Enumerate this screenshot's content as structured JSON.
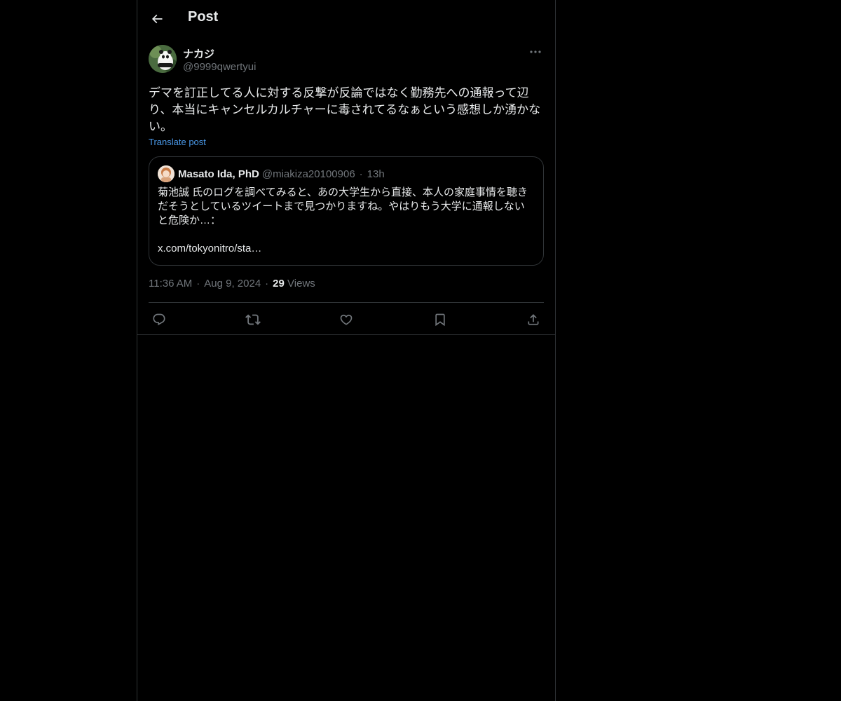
{
  "header": {
    "title": "Post"
  },
  "post": {
    "author_name": "ナカジ",
    "author_handle": "@9999qwertyui",
    "text": "デマを訂正してる人に対する反撃が反論ではなく勤務先への通報って辺り、本当にキャンセルカルチャーに毒されてるなぁという感想しか湧かない。",
    "translate_label": "Translate post",
    "quote": {
      "author_name": "Masato Ida, PhD",
      "author_handle": "@miakiza20100906",
      "separator": "·",
      "time": "13h",
      "text": "菊池誠 氏のログを調べてみると、あの大学生から直接、本人の家庭事情を聴きだそうとしているツイートまで見つかりますね。やはりもう大学に通報しないと危険か…：\n\nx.com/tokyonitro/sta…"
    },
    "time": "11:36 AM",
    "separator": "·",
    "date": "Aug 9, 2024",
    "views_count": "29",
    "views_label": "Views"
  },
  "icons": {
    "back": "arrow-left-icon",
    "more": "more-horizontal-icon",
    "reply": "reply-icon",
    "repost": "repost-icon",
    "like": "heart-icon",
    "bookmark": "bookmark-icon",
    "share": "share-icon"
  },
  "colors": {
    "background": "#000000",
    "text": "#e7e9ea",
    "secondary": "#71767b",
    "link": "#4a99e9",
    "border": "#2f3336"
  }
}
